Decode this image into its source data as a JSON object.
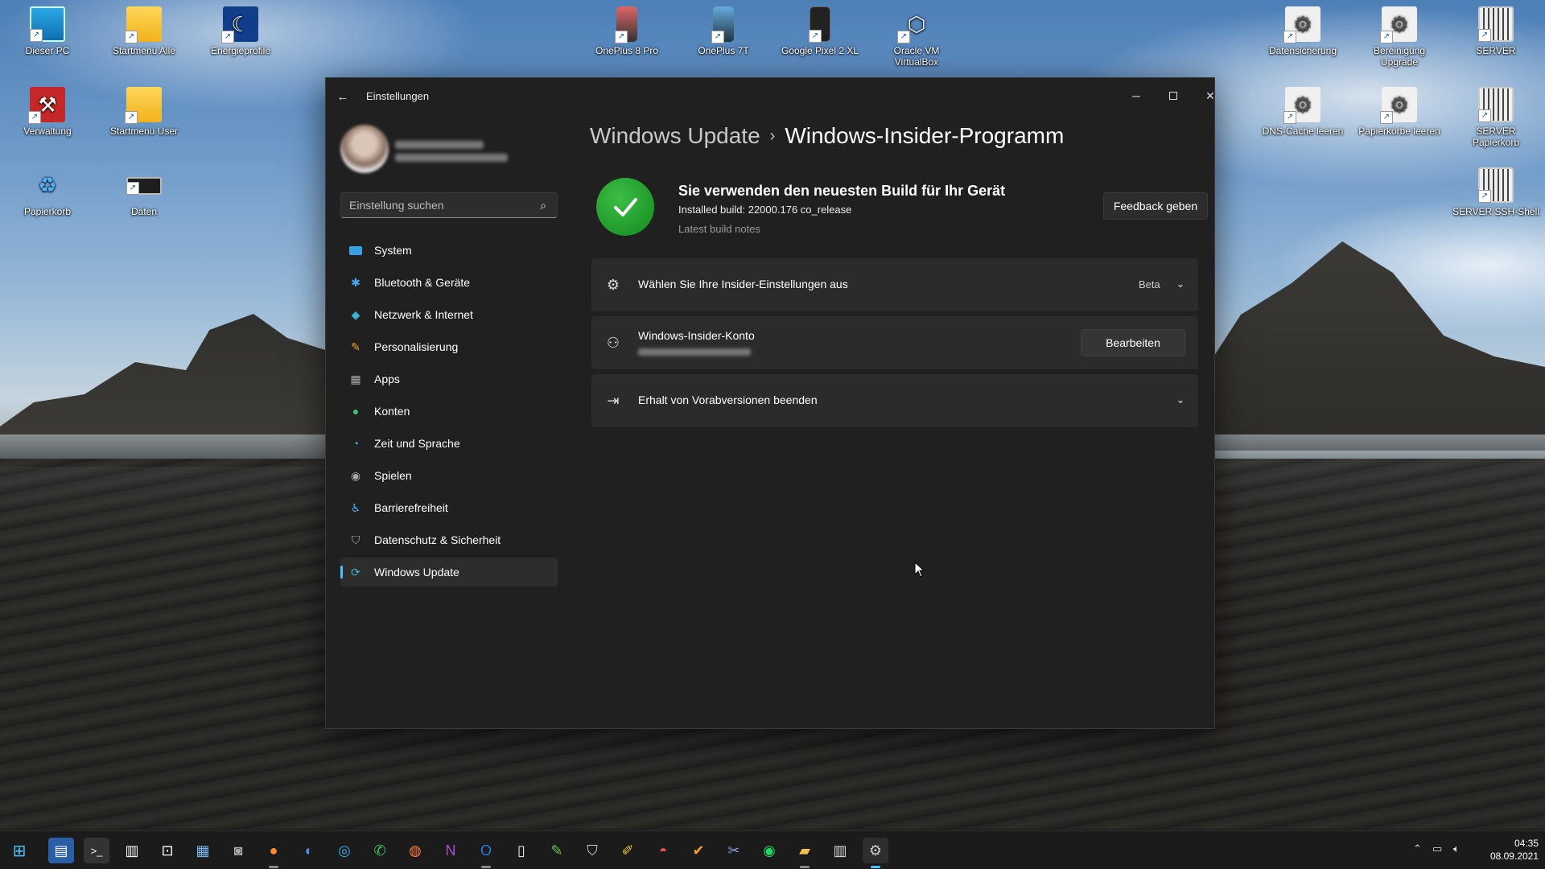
{
  "desktop": {
    "icons": [
      {
        "label": "Dieser PC"
      },
      {
        "label": "Startmenü Alle"
      },
      {
        "label": "Energieprofile"
      },
      {
        "label": "Verwaltung"
      },
      {
        "label": "Startmenü User"
      },
      {
        "label": "Papierkorb"
      },
      {
        "label": "Daten"
      },
      {
        "label": "OnePlus 8 Pro"
      },
      {
        "label": "OnePlus 7T"
      },
      {
        "label": "Google Pixel 2 XL"
      },
      {
        "label": "Oracle VM VirtualBox"
      },
      {
        "label": "Datensicherung"
      },
      {
        "label": "Bereinigung Upgrade"
      },
      {
        "label": "SERVER"
      },
      {
        "label": "DNS-Cache leeren"
      },
      {
        "label": "Papierkörbe leeren"
      },
      {
        "label": "SERVER Papierkorb"
      },
      {
        "label": "SERVER SSH-Shell"
      }
    ]
  },
  "window": {
    "title": "Einstellungen",
    "back_icon": "arrow-left-icon",
    "controls": {
      "minimize": "─",
      "close": "✕"
    }
  },
  "search": {
    "placeholder": "Einstellung suchen",
    "icon": "search-icon"
  },
  "sidebar": {
    "items": [
      {
        "label": "System",
        "icon": "monitor-icon"
      },
      {
        "label": "Bluetooth & Geräte",
        "icon": "bluetooth-icon"
      },
      {
        "label": "Netzwerk & Internet",
        "icon": "wifi-icon"
      },
      {
        "label": "Personalisierung",
        "icon": "brush-icon"
      },
      {
        "label": "Apps",
        "icon": "apps-icon"
      },
      {
        "label": "Konten",
        "icon": "person-icon"
      },
      {
        "label": "Zeit und Sprache",
        "icon": "globe-clock-icon"
      },
      {
        "label": "Spielen",
        "icon": "gamepad-icon"
      },
      {
        "label": "Barrierefreiheit",
        "icon": "accessibility-icon"
      },
      {
        "label": "Datenschutz & Sicherheit",
        "icon": "shield-icon"
      },
      {
        "label": "Windows Update",
        "icon": "sync-icon",
        "active": true
      }
    ]
  },
  "breadcrumb": {
    "parent": "Windows Update",
    "separator": "›",
    "current": "Windows-Insider-Programm"
  },
  "status": {
    "title": "Sie verwenden den neuesten Build für Ihr Gerät",
    "build": "Installed build: 22000.176 co_release",
    "notes_link": "Latest build notes",
    "feedback_button": "Feedback geben"
  },
  "cards": {
    "insider_settings": {
      "label": "Wählen Sie Ihre Insider-Einstellungen aus",
      "value": "Beta"
    },
    "account": {
      "label": "Windows-Insider-Konto",
      "button": "Bearbeiten"
    },
    "stop": {
      "label": "Erhalt von Vorabversionen beenden"
    }
  },
  "taskbar": {
    "clock_time": "04:35",
    "clock_date": "08.09.2021"
  },
  "colors": {
    "accent": "#4cc2ff",
    "success": "#2da835",
    "window_bg": "#202020",
    "card_bg": "#2b2b2b"
  }
}
